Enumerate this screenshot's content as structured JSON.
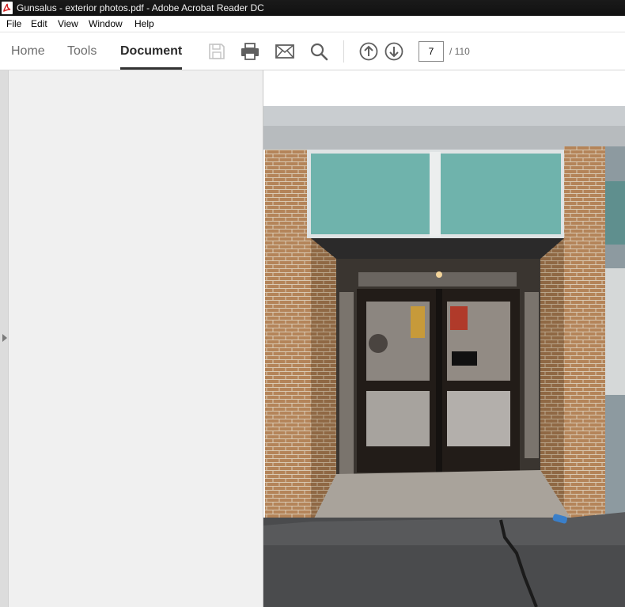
{
  "window": {
    "title": "Gunsalus - exterior photos.pdf - Adobe Acrobat Reader DC",
    "app_icon": "pdf-file-icon"
  },
  "menu": {
    "items": [
      "File",
      "Edit",
      "View",
      "Window",
      "Help"
    ]
  },
  "tabs": [
    {
      "label": "Home",
      "active": false
    },
    {
      "label": "Tools",
      "active": false
    },
    {
      "label": "Document",
      "active": true
    }
  ],
  "toolbar": {
    "icons": [
      "save-icon",
      "print-icon",
      "email-icon",
      "search-icon",
      "previous-page-icon",
      "next-page-icon"
    ],
    "save_enabled": false
  },
  "pagination": {
    "current_page": "7",
    "total_pages": "/ 110"
  },
  "colors": {
    "title_bar": "#141414",
    "toolbar_bg": "#ffffff",
    "icon_gray": "#5f5f5f",
    "pane_bg": "#f0f0f0",
    "page_bg": "#ffffff"
  }
}
